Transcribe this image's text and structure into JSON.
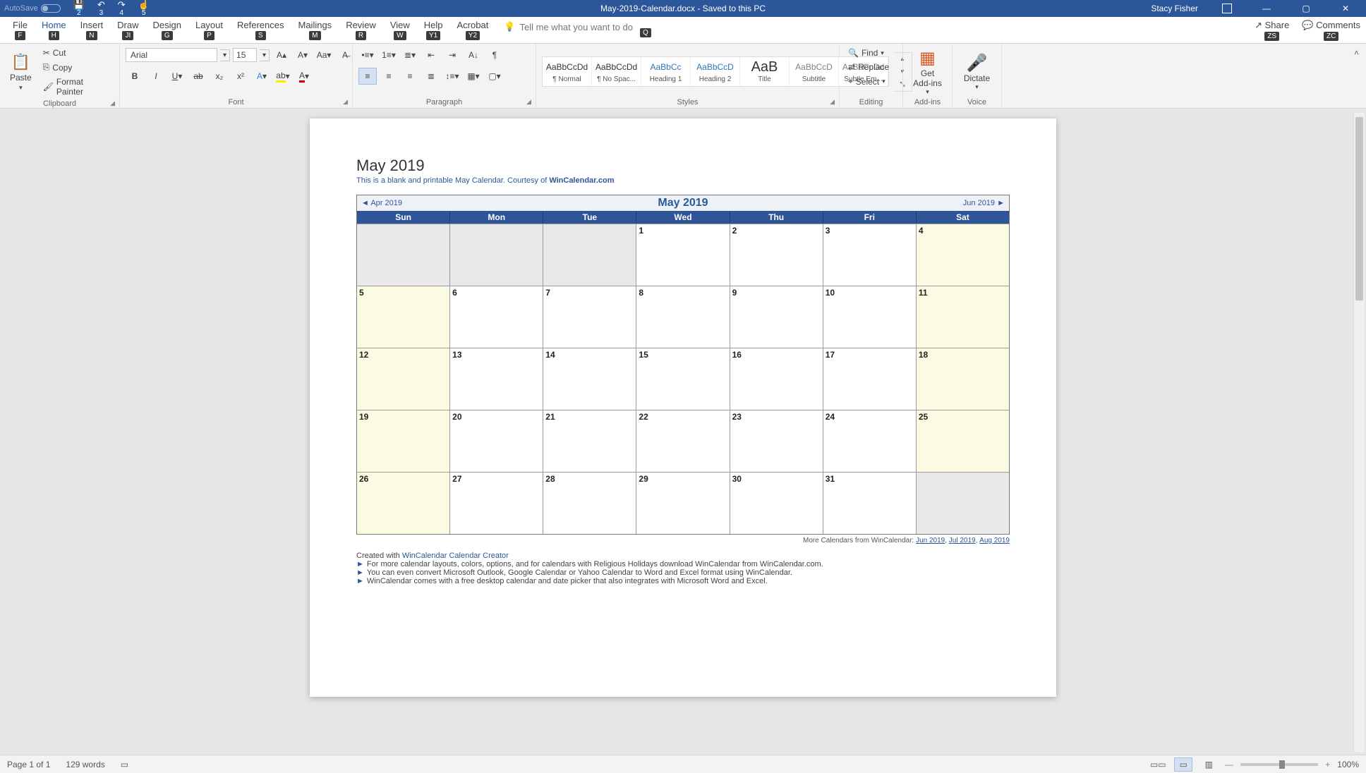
{
  "titlebar": {
    "autosave": "AutoSave",
    "qat": [
      "2",
      "3",
      "4",
      "5"
    ],
    "docname": "May-2019-Calendar.docx  -  Saved to this PC",
    "user": "Stacy Fisher"
  },
  "tabs": {
    "items": [
      {
        "label": "File",
        "key": "F"
      },
      {
        "label": "Home",
        "key": "H"
      },
      {
        "label": "Insert",
        "key": "N"
      },
      {
        "label": "Draw",
        "key": "JI"
      },
      {
        "label": "Design",
        "key": "G"
      },
      {
        "label": "Layout",
        "key": "P"
      },
      {
        "label": "References",
        "key": "S"
      },
      {
        "label": "Mailings",
        "key": "M"
      },
      {
        "label": "Review",
        "key": "R"
      },
      {
        "label": "View",
        "key": "W"
      },
      {
        "label": "Help",
        "key": "Y1"
      },
      {
        "label": "Acrobat",
        "key": "Y2"
      }
    ],
    "tellme_placeholder": "Tell me what you want to do",
    "tellme_key": "Q",
    "share": "Share",
    "share_key": "ZS",
    "comments": "Comments",
    "comments_key": "ZC"
  },
  "ribbon": {
    "clipboard": {
      "paste": "Paste",
      "cut": "Cut",
      "copy": "Copy",
      "format_painter": "Format Painter",
      "label": "Clipboard"
    },
    "font": {
      "name": "Arial",
      "size": "15",
      "label": "Font"
    },
    "paragraph": {
      "label": "Paragraph"
    },
    "styles": {
      "label": "Styles",
      "items": [
        {
          "preview": "AaBbCcDd",
          "name": "¶ Normal"
        },
        {
          "preview": "AaBbCcDd",
          "name": "¶ No Spac..."
        },
        {
          "preview": "AaBbCc",
          "name": "Heading 1"
        },
        {
          "preview": "AaBbCcD",
          "name": "Heading 2"
        },
        {
          "preview": "AaB",
          "name": "Title"
        },
        {
          "preview": "AaBbCcD",
          "name": "Subtitle"
        },
        {
          "preview": "AaBbCcDd",
          "name": "Subtle Em..."
        }
      ]
    },
    "editing": {
      "find": "Find",
      "replace": "Replace",
      "select": "Select",
      "label": "Editing"
    },
    "addins": {
      "get": "Get",
      "addins": "Add-ins",
      "label": "Add-ins"
    },
    "voice": {
      "dictate": "Dictate",
      "label": "Voice"
    }
  },
  "doc": {
    "title": "May 2019",
    "subtitle_a": "This is a blank and printable May Calendar.  Courtesy of ",
    "subtitle_b": "WinCalendar.com",
    "prev": "◄ Apr 2019",
    "mid": "May   2019",
    "next": "Jun 2019 ►",
    "dow": [
      "Sun",
      "Mon",
      "Tue",
      "Wed",
      "Thu",
      "Fri",
      "Sat"
    ],
    "rows": [
      [
        {
          "n": "",
          "c": "gray"
        },
        {
          "n": "",
          "c": "gray"
        },
        {
          "n": "",
          "c": "gray"
        },
        {
          "n": "1",
          "c": ""
        },
        {
          "n": "2",
          "c": ""
        },
        {
          "n": "3",
          "c": ""
        },
        {
          "n": "4",
          "c": "yellow"
        }
      ],
      [
        {
          "n": "5",
          "c": "yellow"
        },
        {
          "n": "6",
          "c": ""
        },
        {
          "n": "7",
          "c": ""
        },
        {
          "n": "8",
          "c": ""
        },
        {
          "n": "9",
          "c": ""
        },
        {
          "n": "10",
          "c": ""
        },
        {
          "n": "11",
          "c": "yellow"
        }
      ],
      [
        {
          "n": "12",
          "c": "yellow"
        },
        {
          "n": "13",
          "c": ""
        },
        {
          "n": "14",
          "c": ""
        },
        {
          "n": "15",
          "c": ""
        },
        {
          "n": "16",
          "c": ""
        },
        {
          "n": "17",
          "c": ""
        },
        {
          "n": "18",
          "c": "yellow"
        }
      ],
      [
        {
          "n": "19",
          "c": "yellow"
        },
        {
          "n": "20",
          "c": ""
        },
        {
          "n": "21",
          "c": ""
        },
        {
          "n": "22",
          "c": ""
        },
        {
          "n": "23",
          "c": ""
        },
        {
          "n": "24",
          "c": ""
        },
        {
          "n": "25",
          "c": "yellow"
        }
      ],
      [
        {
          "n": "26",
          "c": "yellow"
        },
        {
          "n": "27",
          "c": ""
        },
        {
          "n": "28",
          "c": ""
        },
        {
          "n": "29",
          "c": ""
        },
        {
          "n": "30",
          "c": ""
        },
        {
          "n": "31",
          "c": ""
        },
        {
          "n": "",
          "c": "gray"
        }
      ]
    ],
    "more_pre": "More Calendars from WinCalendar: ",
    "more_links": [
      "Jun 2019",
      "Jul 2019",
      "Aug 2019"
    ],
    "created_pre": "Created with ",
    "created_link": "WinCalendar Calendar Creator",
    "bullets": [
      "For more calendar layouts, colors, options, and for calendars with Religious Holidays download WinCalendar from WinCalendar.com.",
      "You can even convert Microsoft Outlook, Google Calendar or Yahoo Calendar to Word and Excel format using WinCalendar.",
      "WinCalendar comes with a free desktop calendar and date picker that also integrates with Microsoft Word and Excel."
    ]
  },
  "status": {
    "page": "Page 1 of 1",
    "words": "129 words",
    "zoom": "100%"
  }
}
